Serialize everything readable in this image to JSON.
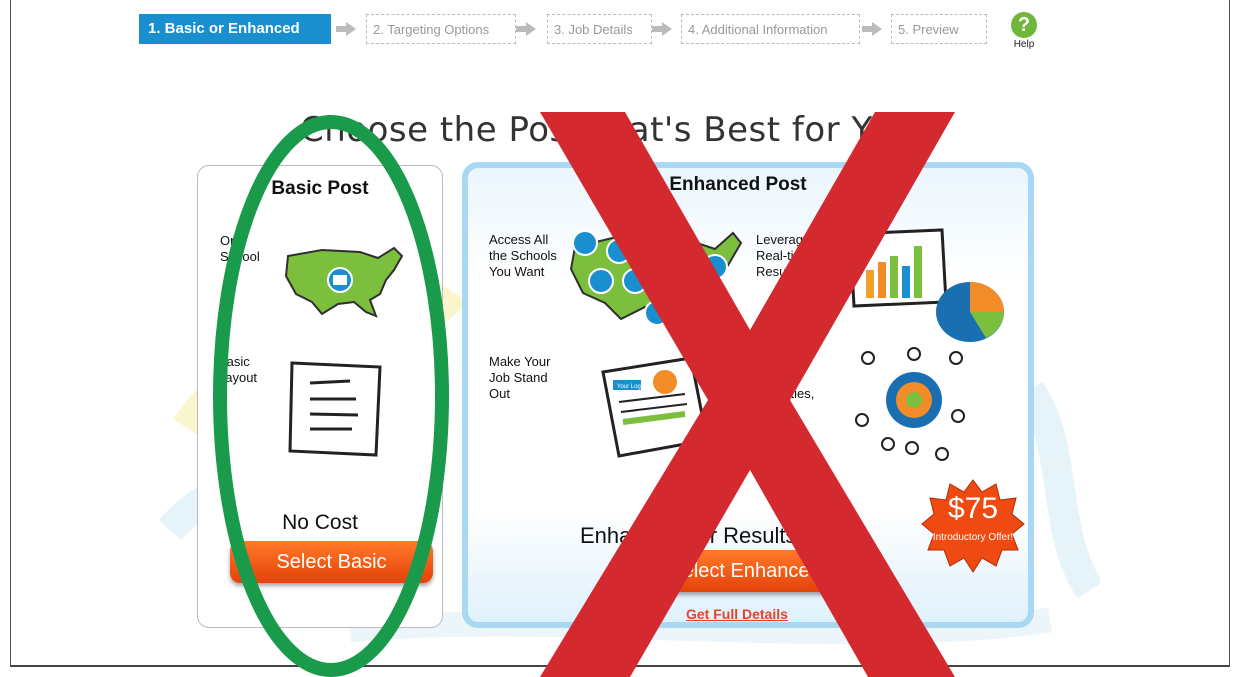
{
  "steps": [
    {
      "label": "1. Basic or Enhanced",
      "active": true
    },
    {
      "label": "2. Targeting Options",
      "active": false
    },
    {
      "label": "3. Job Details",
      "active": false
    },
    {
      "label": "4. Additional Information",
      "active": false
    },
    {
      "label": "5. Preview",
      "active": false
    }
  ],
  "help_label": "Help",
  "headline": "Choose the Post that's Best for You",
  "basic": {
    "title": "Basic Post",
    "feature1": "One School",
    "feature2": "Basic Layout",
    "cost": "No Cost",
    "button": "Select Basic"
  },
  "enhanced": {
    "title": "Enhanced Post",
    "feature1": "Access All the Schools You Want",
    "feature2": "Leverage Real-time Results",
    "feature3": "Make Your Job Stand Out",
    "feature4": "Target Honor Societies,",
    "tagline": "Enhance Your Results $150",
    "button": "Select Enhanced",
    "link": "Get Full Details",
    "logo_text": "Your Logo"
  },
  "badge": {
    "price": "$75",
    "offer": "Introductory Offer!"
  },
  "colors": {
    "accent": "#1a8fd0",
    "button": "#e4420a",
    "circle": "#1a9b4b",
    "cross": "#d42a2f"
  }
}
